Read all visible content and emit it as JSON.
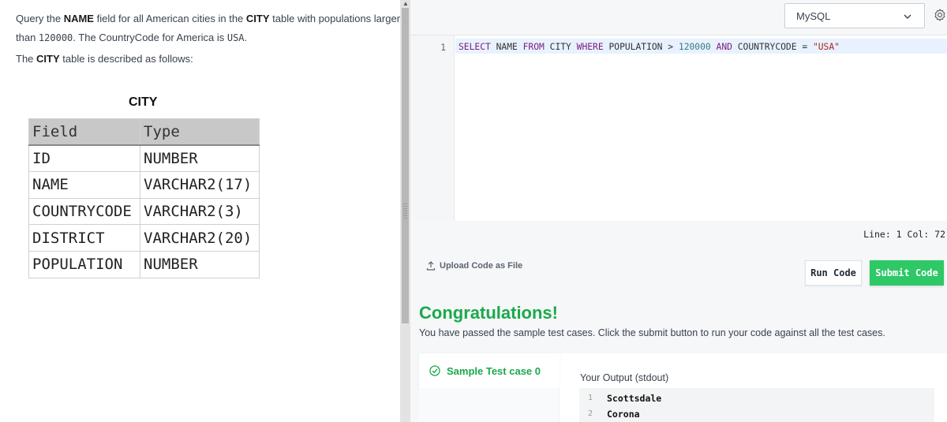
{
  "problem": {
    "line1_prefix": "Query the ",
    "line1_bold1": "NAME",
    "line1_mid": " field for all American cities in the ",
    "line1_bold2": "CITY",
    "line1_suffix": " table with populations larger",
    "line2_prefix": "than ",
    "line2_code1": "120000",
    "line2_mid": ". The CountryCode for America is ",
    "line2_code2": "USA",
    "line2_suffix": ".",
    "line3_prefix": "The ",
    "line3_bold": "CITY",
    "line3_suffix": " table is described as follows:"
  },
  "city_table": {
    "title": "CITY",
    "headers": [
      "Field",
      "Type"
    ],
    "rows": [
      [
        "ID",
        "NUMBER"
      ],
      [
        "NAME",
        "VARCHAR2(17)"
      ],
      [
        "COUNTRYCODE",
        "VARCHAR2(3)"
      ],
      [
        "DISTRICT",
        "VARCHAR2(20)"
      ],
      [
        "POPULATION",
        "NUMBER"
      ]
    ]
  },
  "editor": {
    "language": "MySQL",
    "line_number": "1",
    "code": {
      "t1": "SELECT",
      "t2": " NAME ",
      "t3": "FROM",
      "t4": " CITY ",
      "t5": "WHERE",
      "t6": " POPULATION > ",
      "t7": "120000",
      "t8": " ",
      "t9": "AND",
      "t10": " COUNTRYCODE = ",
      "t11": "\"USA\""
    },
    "status": "Line: 1 Col: 72"
  },
  "actions": {
    "upload_label": "Upload Code as File",
    "run_label": "Run Code",
    "submit_label": "Submit Code"
  },
  "result": {
    "title": "Congratulations!",
    "message": "You have passed the sample test cases. Click the submit button to run your code against all the test cases.",
    "test_case_label": "Sample Test case 0",
    "output_label": "Your Output (stdout)",
    "output_lines": [
      {
        "n": "1",
        "v": "Scottsdale"
      },
      {
        "n": "2",
        "v": "Corona"
      }
    ]
  },
  "colors": {
    "accent_green": "#1ba94c",
    "submit_green": "#2ec866",
    "keyword": "#7a1e7a",
    "string": "#b0241f"
  },
  "icons": [
    "chevron-down-icon",
    "gear-icon",
    "upload-icon",
    "check-circle-icon"
  ]
}
